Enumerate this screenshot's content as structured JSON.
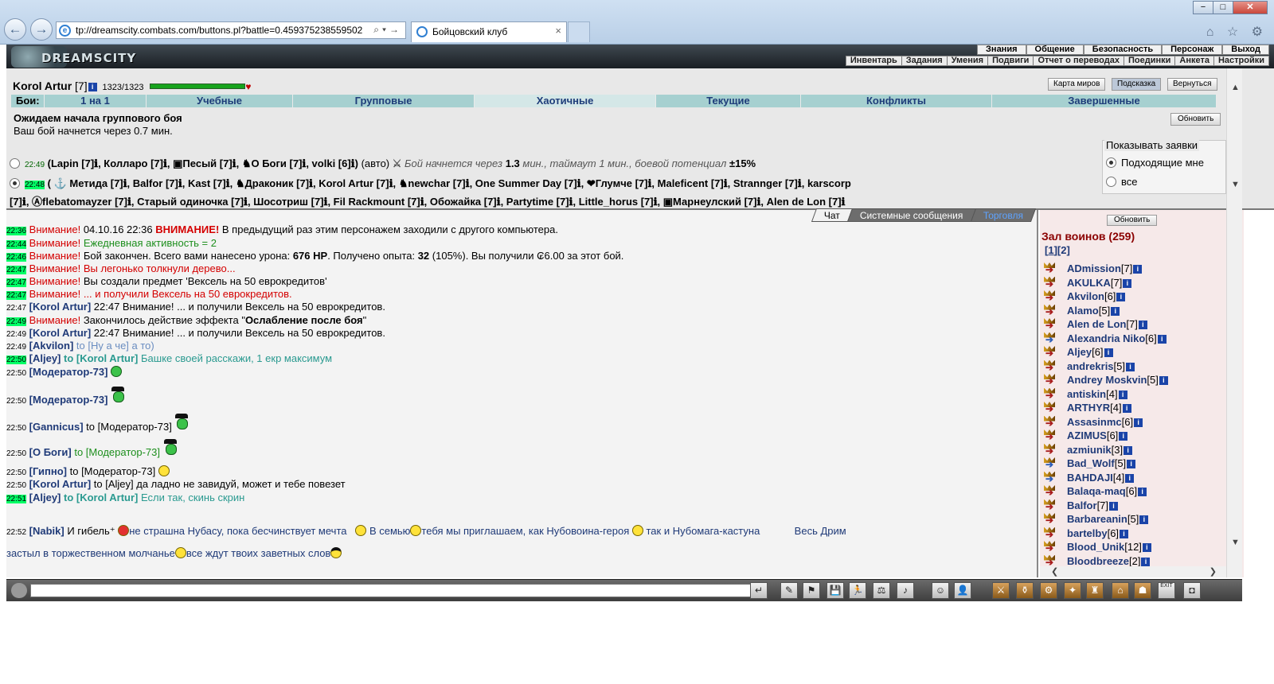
{
  "browser": {
    "url": "tp://dreamscity.combats.com/buttons.pl?battle=0.459375238559502",
    "tab_title": "Бойцовский клуб",
    "tab_close": "×",
    "back": "←",
    "forward": "→",
    "win_min": "−",
    "win_max": "□",
    "win_close": "✕",
    "icons": "⌂ ☆ ⚙"
  },
  "game": {
    "logo_text": "DREAMSCITY",
    "menu_top": [
      "Знания",
      "Общение",
      "Безопасность",
      "Персонаж",
      "Выход"
    ],
    "menu_sub": [
      "Инвентарь",
      "Задания",
      "Умения",
      "Подвиги",
      "Отчет о переводах",
      "Поединки",
      "Анкета",
      "Настройки"
    ]
  },
  "character": {
    "name": "Korol Artur",
    "level": "[7]",
    "hp": "1323/1323",
    "hp_fraction": 1.0
  },
  "top_buttons": {
    "map": "Карта миров",
    "hint": "Подсказка",
    "return": "Вернуться",
    "refresh": "Обновить"
  },
  "battle_tabs": {
    "label": "Бои:",
    "items": [
      "1 на 1",
      "Учебные",
      "Групповые",
      "Хаотичные",
      "Текущие",
      "Конфликты",
      "Завершенные"
    ],
    "active": "Хаотичные"
  },
  "status": {
    "title": "Ожидаем начала группового боя",
    "subtitle": "Ваш бой начнется через 0.7 мин."
  },
  "battles": {
    "row1": {
      "time": "22:49",
      "players": "(Lapin [7]ℹ, Колларо [7]ℹ, ▣Песый [7]ℹ, ♞О Боги [7]ℹ, volki [6]ℹ)",
      "auto": "(авто)",
      "info_prefix": "Бой начнется через ",
      "info_time": "1.3",
      "info_mid": " мин., таймаут 1 мин., боевой потенциал ",
      "info_potential": "±15%"
    },
    "row2": {
      "time": "22:48",
      "players": "( ⚓ Метида [7]ℹ, Balfor [7]ℹ, Kast [7]ℹ, ♞Драконик [7]ℹ, Korol Artur [7]ℹ, ♞newchar [7]ℹ, One Summer Day [7]ℹ, ❤Глумче [7]ℹ, Maleficent [7]ℹ, Strannger [7]ℹ, karscorp"
    },
    "row3": {
      "players": "[7]ℹ, Ⓐflebatomayzer [7]ℹ, Старый одиночка [7]ℹ, Шосотриш [7]ℹ, Fil Rackmount [7]ℹ, Обожайка [7]ℹ, Partytime [7]ℹ, Little_horus [7]ℹ, ▣Марнеулский [7]ℹ, Alen de Lon [7]ℹ"
    }
  },
  "filter": {
    "title": "Показывать заявки",
    "option1": "Подходящие мне",
    "option2": "все",
    "selected": "Подходящие мне"
  },
  "chat_tabs": [
    "Чат",
    "Системные сообщения",
    "Торговля"
  ],
  "chat": {
    "m1": {
      "time": "22:36",
      "label": "Внимание!",
      "date": " 04.10.16 22:36 ",
      "strong": "ВНИМАНИЕ!",
      "text": " В предыдущий раз этим персонажем заходили с другого компьютера."
    },
    "m2": {
      "time": "22:44",
      "label": "Внимание!",
      "text": " Ежедневная активность = 2"
    },
    "m3": {
      "time": "22:46",
      "label": "Внимание!",
      "t1": " Бой закончен. Всего вами нанесено урона: ",
      "dmg": "676 HP",
      "t2": ". Получено опыта: ",
      "exp": "32",
      "t3": " (105%). Вы получили ₢6.00 за этот бой."
    },
    "m4": {
      "time": "22:47",
      "text": "Внимание! Вы легонько толкнули дерево..."
    },
    "m5": {
      "time": "22:47",
      "label": "Внимание!",
      "text": " Вы создали предмет 'Вексель на 50 еврокредитов'"
    },
    "m6": {
      "time": "22:47",
      "text": "Внимание! ... и получили Вексель на 50 еврокредитов."
    },
    "m7": {
      "time": "22:47",
      "nick": "[Korol Artur]",
      "text": " 22:47 Внимание! ... и получили Вексель на 50 еврокредитов."
    },
    "m8": {
      "time": "22:49",
      "label": "Внимание!",
      "t1": " Закончилось действие эффекта \"",
      "effect": "Ослабление после боя",
      "t2": "\""
    },
    "m9": {
      "time": "22:49",
      "nick": "[Korol Artur]",
      "text": " 22:47 Внимание! ... и получили Вексель на 50 еврокредитов."
    },
    "m10": {
      "time": "22:49",
      "nick": "[Akvilon]",
      "to": " to [Ну а че] а то)"
    },
    "m11": {
      "time": "22:50",
      "nick": "[Aljey]",
      "to": " to [Korol Artur]",
      "text": " Башке своей расскажи, 1 екр максимум"
    },
    "m12": {
      "time": "22:50",
      "nick": "[Модератор-73]"
    },
    "m13": {
      "time": "22:50",
      "nick": "[Модератор-73]"
    },
    "m14": {
      "time": "22:50",
      "nick": "[Gannicus]",
      "to": " to [Модератор-73]"
    },
    "m15": {
      "time": "22:50",
      "nick": "[О Боги]",
      "to": " to [Модератор-73]"
    },
    "m16": {
      "time": "22:50",
      "nick": "[Гипно]",
      "to": " to [Модератор-73]"
    },
    "m17": {
      "time": "22:50",
      "nick": "[Korol Artur]",
      "to": " to [Aljey]",
      "text": " да ладно не завидуй, может и тебе повезет"
    },
    "m18": {
      "time": "22:51",
      "nick": "[Aljey]",
      "to": " to [Korol Artur]",
      "text": " Если так, скинь скрин"
    },
    "m19": {
      "time": "22:52",
      "nick": "[Nabik]",
      "p1": " И гибель⁺ ",
      "p2": "не страшна Нубасу, пока бесчинствует мечта",
      "p3": " В семью",
      "p4": "тебя мы приглашаем, как Нубовоина-героя",
      "p5": " так и Нубомага-кастуна",
      "p6": "Весь Дрим"
    },
    "m20": {
      "p1": "застыл в торжественном молчанье",
      "p2": "все ждут твоих заветных слов"
    }
  },
  "hall": {
    "refresh": "Обновить",
    "title": "Зал воинов (259)",
    "page1": "1",
    "page2": "2",
    "users": [
      {
        "name": "ADmission",
        "level": "[7]",
        "arrow": "red"
      },
      {
        "name": "AKULKA",
        "level": "[7]",
        "arrow": "red"
      },
      {
        "name": "Akvilon",
        "level": "[6]",
        "arrow": "red"
      },
      {
        "name": "Alamo",
        "level": "[5]",
        "arrow": "red"
      },
      {
        "name": "Alen de Lon",
        "level": "[7]",
        "arrow": "red"
      },
      {
        "name": "Alexandria Niko",
        "level": "[6]",
        "arrow": "blue"
      },
      {
        "name": "Aljey",
        "level": "[6]",
        "arrow": "red"
      },
      {
        "name": "andrekris",
        "level": "[5]",
        "arrow": "red"
      },
      {
        "name": "Andrey Moskvin",
        "level": "[5]",
        "arrow": "red"
      },
      {
        "name": "antiskin",
        "level": "[4]",
        "arrow": "red"
      },
      {
        "name": "ARTHYR",
        "level": "[4]",
        "arrow": "red"
      },
      {
        "name": "Assasinmc",
        "level": "[6]",
        "arrow": "red"
      },
      {
        "name": "AZIMUS",
        "level": "[6]",
        "arrow": "red"
      },
      {
        "name": "azmiunik",
        "level": "[3]",
        "arrow": "red"
      },
      {
        "name": "Bad_Wolf",
        "level": "[5]",
        "arrow": "blue"
      },
      {
        "name": "BAHDAJI",
        "level": "[4]",
        "arrow": "blue"
      },
      {
        "name": "Balaqa-maq",
        "level": "[6]",
        "arrow": "red"
      },
      {
        "name": "Balfor",
        "level": "[7]",
        "arrow": "red"
      },
      {
        "name": "Barbareanin",
        "level": "[5]",
        "arrow": "red"
      },
      {
        "name": "bartelby",
        "level": "[6]",
        "arrow": "red"
      },
      {
        "name": "Blood_Unik",
        "level": "[12]",
        "arrow": "red"
      },
      {
        "name": "Bloodbreeze",
        "level": "[2]",
        "arrow": "red"
      }
    ]
  },
  "toolbar": {
    "input_value": "",
    "buttons": [
      "↵",
      "✎",
      "⚑",
      "💾",
      "🏃",
      "⚖",
      "♪",
      "☺",
      "👤",
      "⚔",
      "⚱",
      "⚙",
      "✦",
      "♜",
      "⌂",
      "☗",
      "EXIT",
      "◘"
    ]
  },
  "colors": {
    "accent_tab": "#a6d0d0",
    "hp_bar": "#17a31d",
    "hall_bg": "#f6e9e9",
    "timestamp_green": "#00ff66"
  },
  "icon_names": [
    "back-arrow-icon",
    "forward-arrow-icon",
    "ie-icon",
    "home-icon",
    "star-icon",
    "gear-icon",
    "info-icon",
    "heart-icon",
    "rank-crown-icon",
    "arrow-icon",
    "radio-icon",
    "smiley-icon",
    "hat-smiley-icon"
  ]
}
